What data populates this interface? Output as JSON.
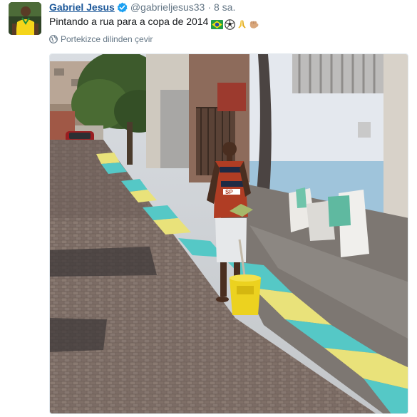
{
  "tweet": {
    "author_name": "Gabriel Jesus",
    "handle": "@gabrieljesus33",
    "separator": "·",
    "time": "8 sa.",
    "text": "Pintando a rua para a copa de 2014",
    "emojis": [
      "brazil-flag-icon",
      "soccer-ball-icon",
      "praying-hands-icon",
      "fist-bump-icon"
    ],
    "translate_label": "Portekizce dilinden çevir",
    "photo_shirt_text": "SP"
  },
  "colors": {
    "link": "#1b5799",
    "muted": "#657786",
    "verified": "#1da1f2",
    "curb_yellow": "#e9e27a",
    "curb_blue": "#55c8c6",
    "cobblestone": "#7a6a62"
  }
}
